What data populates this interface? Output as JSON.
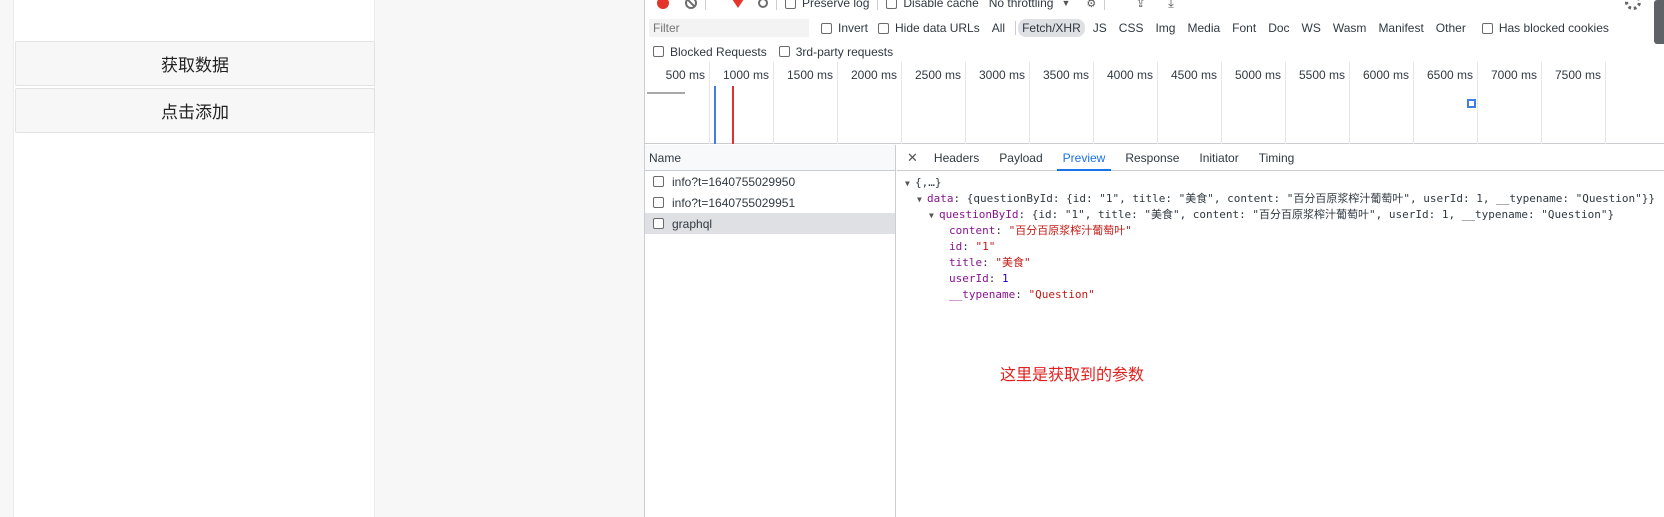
{
  "app": {
    "fetch_button": "获取数据",
    "add_button": "点击添加"
  },
  "devtools": {
    "toolbar": {
      "preserve_log": "Preserve log",
      "disable_cache": "Disable cache",
      "throttling": "No throttling"
    },
    "filter": {
      "placeholder": "Filter",
      "invert": "Invert",
      "hide_data_urls": "Hide data URLs",
      "types": [
        "All",
        "Fetch/XHR",
        "JS",
        "CSS",
        "Img",
        "Media",
        "Font",
        "Doc",
        "WS",
        "Wasm",
        "Manifest",
        "Other"
      ],
      "active_type": "Fetch/XHR",
      "has_blocked_cookies": "Has blocked cookies",
      "blocked_requests": "Blocked Requests",
      "third_party": "3rd-party requests"
    },
    "timeline": {
      "ticks": [
        "500 ms",
        "1000 ms",
        "1500 ms",
        "2000 ms",
        "2500 ms",
        "3000 ms",
        "3500 ms",
        "4000 ms",
        "4500 ms",
        "5000 ms",
        "5500 ms",
        "6000 ms",
        "6500 ms",
        "7000 ms",
        "7500 ms"
      ]
    },
    "requests": {
      "header": "Name",
      "items": [
        "info?t=1640755029950",
        "info?t=1640755029951",
        "graphql"
      ]
    },
    "detail": {
      "tabs": [
        "Headers",
        "Payload",
        "Preview",
        "Response",
        "Initiator",
        "Timing"
      ],
      "active_tab": "Preview",
      "json": {
        "root": "{,…}",
        "data_key": "data",
        "data_summary": "{questionById: {id: \"1\", title: \"美食\", content: \"百分百原浆榨汁葡萄叶\", userId: 1, __typename: \"Question\"}}",
        "question_key": "questionById",
        "question_summary": "{id: \"1\", title: \"美食\", content: \"百分百原浆榨汁葡萄叶\", userId: 1, __typename: \"Question\"}",
        "content_key": "content",
        "content_val": "\"百分百原浆榨汁葡萄叶\"",
        "id_key": "id",
        "id_val": "\"1\"",
        "title_key": "title",
        "title_val": "\"美食\"",
        "userid_key": "userId",
        "userid_val": "1",
        "typename_key": "__typename",
        "typename_val": "\"Question\""
      },
      "annotation": "这里是获取到的参数"
    }
  }
}
